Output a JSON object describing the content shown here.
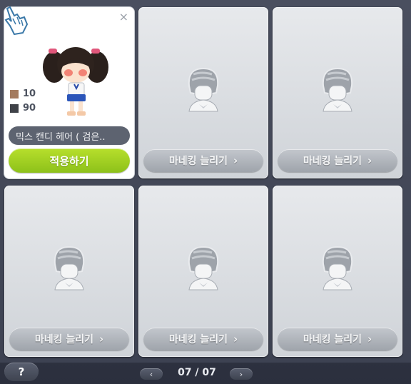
{
  "slots": [
    {
      "type": "active",
      "name": "믹스 캔디 헤어 ( 검은..",
      "apply_label": "적용하기",
      "stats": [
        {
          "color": "#a47b5f",
          "value": "10"
        },
        {
          "color": "#3f4248",
          "value": "90"
        }
      ]
    },
    {
      "type": "locked",
      "label": "마네킹 늘리기"
    },
    {
      "type": "locked",
      "label": "마네킹 늘리기"
    },
    {
      "type": "locked",
      "label": "마네킹 늘리기"
    },
    {
      "type": "locked",
      "label": "마네킹 늘리기"
    },
    {
      "type": "locked",
      "label": "마네킹 늘리기"
    }
  ],
  "chevron": "›",
  "close_glyph": "×",
  "help_label": "?",
  "pager": {
    "text": "07 / 07",
    "prev": "‹",
    "next": "›"
  },
  "icons": {
    "close": "close-icon",
    "cursor": "pointer-cursor-icon",
    "hair": "mannequin-hair-icon"
  }
}
